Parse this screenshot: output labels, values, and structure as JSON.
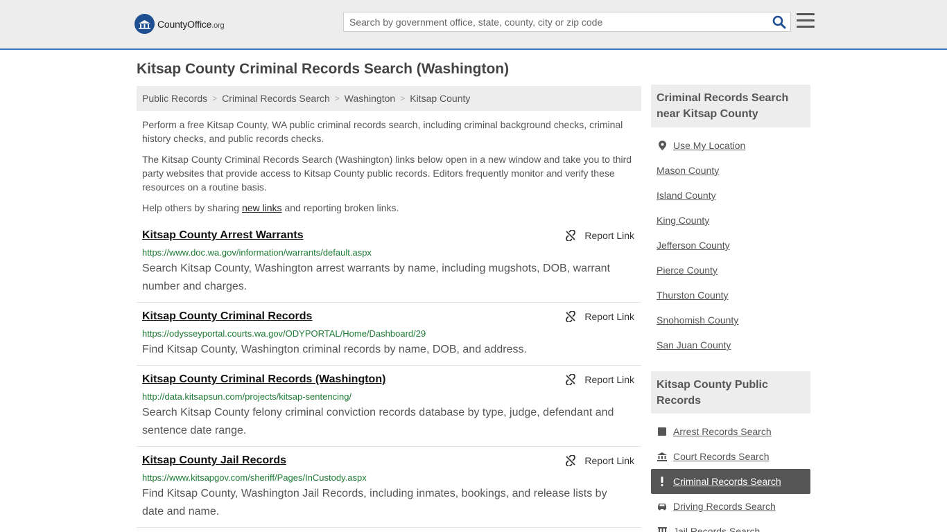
{
  "header": {
    "logo_text": "CountyOffice",
    "logo_suffix": ".org",
    "search_placeholder": "Search by government office, state, county, city or zip code"
  },
  "page_title": "Kitsap County Criminal Records Search (Washington)",
  "breadcrumb": [
    "Public Records",
    "Criminal Records Search",
    "Washington",
    "Kitsap County"
  ],
  "intro": {
    "p1": "Perform a free Kitsap County, WA public criminal records search, including criminal background checks, criminal history checks, and public records checks.",
    "p2": "The Kitsap County Criminal Records Search (Washington) links below open in a new window and take you to third party websites that provide access to Kitsap County public records. Editors frequently monitor and verify these resources on a routine basis.",
    "p3_before": "Help others by sharing ",
    "p3_link": "new links",
    "p3_after": " and reporting broken links."
  },
  "report_label": "Report Link",
  "results": [
    {
      "title": "Kitsap County Arrest Warrants",
      "url": "https://www.doc.wa.gov/information/warrants/default.aspx",
      "desc": "Search Kitsap County, Washington arrest warrants by name, including mugshots, DOB, warrant number and charges."
    },
    {
      "title": "Kitsap County Criminal Records",
      "url": "https://odysseyportal.courts.wa.gov/ODYPORTAL/Home/Dashboard/29",
      "desc": "Find Kitsap County, Washington criminal records by name, DOB, and address."
    },
    {
      "title": "Kitsap County Criminal Records (Washington)",
      "url": "http://data.kitsapsun.com/projects/kitsap-sentencing/",
      "desc": "Search Kitsap County felony criminal conviction records database by type, judge, defendant and sentence date range."
    },
    {
      "title": "Kitsap County Jail Records",
      "url": "https://www.kitsapgov.com/sheriff/Pages/InCustody.aspx",
      "desc": "Find Kitsap County, Washington Jail Records, including inmates, bookings, and release lists by date and name."
    }
  ],
  "sidebar": {
    "nearby_title": "Criminal Records Search near Kitsap County",
    "use_location": "Use My Location",
    "nearby": [
      "Mason County",
      "Island County",
      "King County",
      "Jefferson County",
      "Pierce County",
      "Thurston County",
      "Snohomish County",
      "San Juan County"
    ],
    "public_title": "Kitsap County Public Records",
    "public_items": [
      {
        "label": "Arrest Records Search",
        "icon": "square-icon"
      },
      {
        "label": "Court Records Search",
        "icon": "courthouse-icon"
      },
      {
        "label": "Criminal Records Search",
        "icon": "exclamation-icon"
      },
      {
        "label": "Driving Records Search",
        "icon": "car-icon"
      },
      {
        "label": "Jail Records Search",
        "icon": "jail-icon"
      }
    ]
  }
}
